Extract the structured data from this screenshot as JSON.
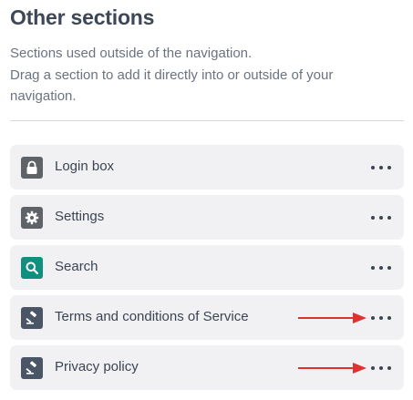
{
  "section": {
    "title": "Other sections",
    "description_line1": "Sections used outside of the navigation.",
    "description_line2": "Drag a section to add it directly into or outside of your",
    "description_line3": "navigation."
  },
  "items": [
    {
      "label": "Login box",
      "icon": "lock-icon",
      "icon_color": "#5f6368"
    },
    {
      "label": "Settings",
      "icon": "gear-icon",
      "icon_color": "#5f6368"
    },
    {
      "label": "Search",
      "icon": "search-icon",
      "icon_color": "#0f8f7e"
    },
    {
      "label": "Terms and conditions of Service",
      "icon": "gavel-icon",
      "icon_color": "#4a5566"
    },
    {
      "label": "Privacy policy",
      "icon": "gavel-icon",
      "icon_color": "#4a5566"
    }
  ],
  "annotation_color": "#e03131"
}
